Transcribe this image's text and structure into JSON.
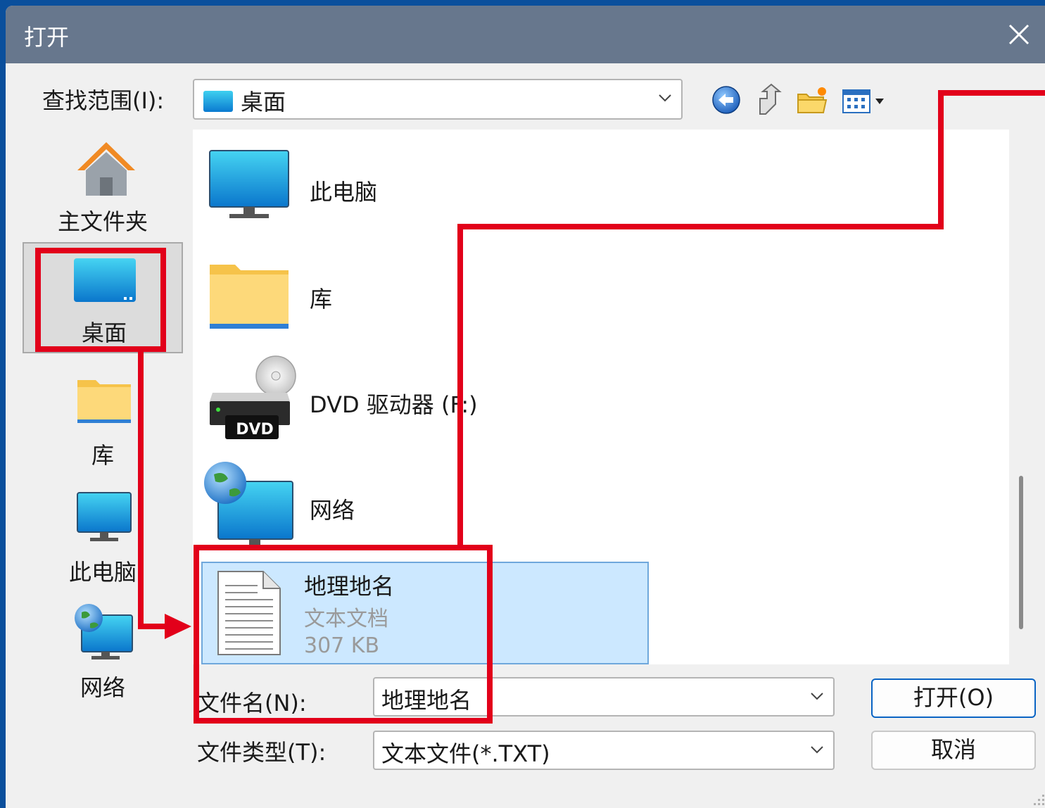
{
  "window": {
    "title": "打开"
  },
  "toolbar": {
    "look_in_label": "查找范围(I):",
    "look_in_value": "桌面",
    "icons": [
      "back-icon",
      "up-folder-icon",
      "new-folder-icon",
      "view-menu-icon"
    ]
  },
  "places": [
    {
      "label": "主文件夹",
      "icon": "home-icon"
    },
    {
      "label": "桌面",
      "icon": "desktop-icon",
      "selected": true
    },
    {
      "label": "库",
      "icon": "folder-icon"
    },
    {
      "label": "此电脑",
      "icon": "monitor-icon"
    },
    {
      "label": "网络",
      "icon": "network-icon"
    }
  ],
  "files": [
    {
      "name": "此电脑",
      "icon": "monitor-icon"
    },
    {
      "name": "库",
      "icon": "folder-icon"
    },
    {
      "name": "DVD 驱动器 (F:)",
      "icon": "dvd-drive-icon",
      "badge": "DVD"
    },
    {
      "name": "网络",
      "icon": "network-icon"
    },
    {
      "name": "地理地名",
      "type": "文本文档",
      "size": "307 KB",
      "icon": "text-file-icon",
      "selected": true
    }
  ],
  "form": {
    "filename_label": "文件名(N):",
    "filename_value": "地理地名",
    "filetype_label": "文件类型(T):",
    "filetype_value": "文本文件(*.TXT)"
  },
  "buttons": {
    "open": "打开(O)",
    "cancel": "取消"
  },
  "colors": {
    "titlebar": "#67778d",
    "annotation": "#e2001a",
    "selection": "#cce8ff"
  }
}
